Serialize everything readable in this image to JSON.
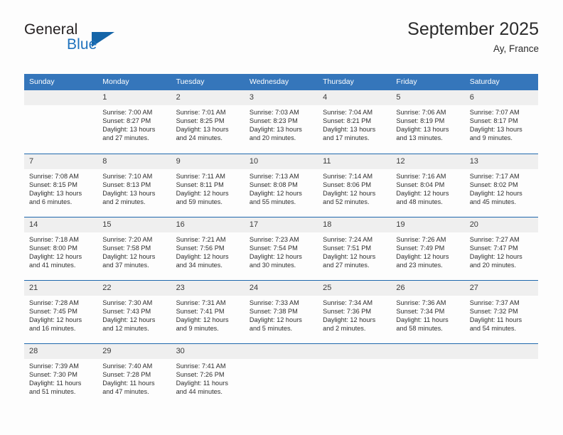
{
  "brand": {
    "name_part1": "General",
    "name_part2": "Blue"
  },
  "header": {
    "title": "September 2025",
    "location": "Ay, France"
  },
  "colors": {
    "header_blue": "#3576bb",
    "week_border_blue": "#1f68ad",
    "daynum_band": "#efefef",
    "brand_blue": "#1f72bd",
    "logo_triangle": "#1565a8",
    "text": "#2f2f2f"
  },
  "weekdays": [
    "Sunday",
    "Monday",
    "Tuesday",
    "Wednesday",
    "Thursday",
    "Friday",
    "Saturday"
  ],
  "labels": {
    "sunrise_prefix": "Sunrise:",
    "sunset_prefix": "Sunset:",
    "daylight_prefix": "Daylight:"
  },
  "weeks": [
    [
      {
        "day": "",
        "empty": true,
        "l1": "",
        "l2": "",
        "l3": "",
        "l4": ""
      },
      {
        "day": "1",
        "empty": false,
        "l1": "Sunrise: 7:00 AM",
        "l2": "Sunset: 8:27 PM",
        "l3": "Daylight: 13 hours",
        "l4": "and 27 minutes."
      },
      {
        "day": "2",
        "empty": false,
        "l1": "Sunrise: 7:01 AM",
        "l2": "Sunset: 8:25 PM",
        "l3": "Daylight: 13 hours",
        "l4": "and 24 minutes."
      },
      {
        "day": "3",
        "empty": false,
        "l1": "Sunrise: 7:03 AM",
        "l2": "Sunset: 8:23 PM",
        "l3": "Daylight: 13 hours",
        "l4": "and 20 minutes."
      },
      {
        "day": "4",
        "empty": false,
        "l1": "Sunrise: 7:04 AM",
        "l2": "Sunset: 8:21 PM",
        "l3": "Daylight: 13 hours",
        "l4": "and 17 minutes."
      },
      {
        "day": "5",
        "empty": false,
        "l1": "Sunrise: 7:06 AM",
        "l2": "Sunset: 8:19 PM",
        "l3": "Daylight: 13 hours",
        "l4": "and 13 minutes."
      },
      {
        "day": "6",
        "empty": false,
        "l1": "Sunrise: 7:07 AM",
        "l2": "Sunset: 8:17 PM",
        "l3": "Daylight: 13 hours",
        "l4": "and 9 minutes."
      }
    ],
    [
      {
        "day": "7",
        "empty": false,
        "l1": "Sunrise: 7:08 AM",
        "l2": "Sunset: 8:15 PM",
        "l3": "Daylight: 13 hours",
        "l4": "and 6 minutes."
      },
      {
        "day": "8",
        "empty": false,
        "l1": "Sunrise: 7:10 AM",
        "l2": "Sunset: 8:13 PM",
        "l3": "Daylight: 13 hours",
        "l4": "and 2 minutes."
      },
      {
        "day": "9",
        "empty": false,
        "l1": "Sunrise: 7:11 AM",
        "l2": "Sunset: 8:11 PM",
        "l3": "Daylight: 12 hours",
        "l4": "and 59 minutes."
      },
      {
        "day": "10",
        "empty": false,
        "l1": "Sunrise: 7:13 AM",
        "l2": "Sunset: 8:08 PM",
        "l3": "Daylight: 12 hours",
        "l4": "and 55 minutes."
      },
      {
        "day": "11",
        "empty": false,
        "l1": "Sunrise: 7:14 AM",
        "l2": "Sunset: 8:06 PM",
        "l3": "Daylight: 12 hours",
        "l4": "and 52 minutes."
      },
      {
        "day": "12",
        "empty": false,
        "l1": "Sunrise: 7:16 AM",
        "l2": "Sunset: 8:04 PM",
        "l3": "Daylight: 12 hours",
        "l4": "and 48 minutes."
      },
      {
        "day": "13",
        "empty": false,
        "l1": "Sunrise: 7:17 AM",
        "l2": "Sunset: 8:02 PM",
        "l3": "Daylight: 12 hours",
        "l4": "and 45 minutes."
      }
    ],
    [
      {
        "day": "14",
        "empty": false,
        "l1": "Sunrise: 7:18 AM",
        "l2": "Sunset: 8:00 PM",
        "l3": "Daylight: 12 hours",
        "l4": "and 41 minutes."
      },
      {
        "day": "15",
        "empty": false,
        "l1": "Sunrise: 7:20 AM",
        "l2": "Sunset: 7:58 PM",
        "l3": "Daylight: 12 hours",
        "l4": "and 37 minutes."
      },
      {
        "day": "16",
        "empty": false,
        "l1": "Sunrise: 7:21 AM",
        "l2": "Sunset: 7:56 PM",
        "l3": "Daylight: 12 hours",
        "l4": "and 34 minutes."
      },
      {
        "day": "17",
        "empty": false,
        "l1": "Sunrise: 7:23 AM",
        "l2": "Sunset: 7:54 PM",
        "l3": "Daylight: 12 hours",
        "l4": "and 30 minutes."
      },
      {
        "day": "18",
        "empty": false,
        "l1": "Sunrise: 7:24 AM",
        "l2": "Sunset: 7:51 PM",
        "l3": "Daylight: 12 hours",
        "l4": "and 27 minutes."
      },
      {
        "day": "19",
        "empty": false,
        "l1": "Sunrise: 7:26 AM",
        "l2": "Sunset: 7:49 PM",
        "l3": "Daylight: 12 hours",
        "l4": "and 23 minutes."
      },
      {
        "day": "20",
        "empty": false,
        "l1": "Sunrise: 7:27 AM",
        "l2": "Sunset: 7:47 PM",
        "l3": "Daylight: 12 hours",
        "l4": "and 20 minutes."
      }
    ],
    [
      {
        "day": "21",
        "empty": false,
        "l1": "Sunrise: 7:28 AM",
        "l2": "Sunset: 7:45 PM",
        "l3": "Daylight: 12 hours",
        "l4": "and 16 minutes."
      },
      {
        "day": "22",
        "empty": false,
        "l1": "Sunrise: 7:30 AM",
        "l2": "Sunset: 7:43 PM",
        "l3": "Daylight: 12 hours",
        "l4": "and 12 minutes."
      },
      {
        "day": "23",
        "empty": false,
        "l1": "Sunrise: 7:31 AM",
        "l2": "Sunset: 7:41 PM",
        "l3": "Daylight: 12 hours",
        "l4": "and 9 minutes."
      },
      {
        "day": "24",
        "empty": false,
        "l1": "Sunrise: 7:33 AM",
        "l2": "Sunset: 7:38 PM",
        "l3": "Daylight: 12 hours",
        "l4": "and 5 minutes."
      },
      {
        "day": "25",
        "empty": false,
        "l1": "Sunrise: 7:34 AM",
        "l2": "Sunset: 7:36 PM",
        "l3": "Daylight: 12 hours",
        "l4": "and 2 minutes."
      },
      {
        "day": "26",
        "empty": false,
        "l1": "Sunrise: 7:36 AM",
        "l2": "Sunset: 7:34 PM",
        "l3": "Daylight: 11 hours",
        "l4": "and 58 minutes."
      },
      {
        "day": "27",
        "empty": false,
        "l1": "Sunrise: 7:37 AM",
        "l2": "Sunset: 7:32 PM",
        "l3": "Daylight: 11 hours",
        "l4": "and 54 minutes."
      }
    ],
    [
      {
        "day": "28",
        "empty": false,
        "l1": "Sunrise: 7:39 AM",
        "l2": "Sunset: 7:30 PM",
        "l3": "Daylight: 11 hours",
        "l4": "and 51 minutes."
      },
      {
        "day": "29",
        "empty": false,
        "l1": "Sunrise: 7:40 AM",
        "l2": "Sunset: 7:28 PM",
        "l3": "Daylight: 11 hours",
        "l4": "and 47 minutes."
      },
      {
        "day": "30",
        "empty": false,
        "l1": "Sunrise: 7:41 AM",
        "l2": "Sunset: 7:26 PM",
        "l3": "Daylight: 11 hours",
        "l4": "and 44 minutes."
      },
      {
        "day": "",
        "empty": true,
        "l1": "",
        "l2": "",
        "l3": "",
        "l4": ""
      },
      {
        "day": "",
        "empty": true,
        "l1": "",
        "l2": "",
        "l3": "",
        "l4": ""
      },
      {
        "day": "",
        "empty": true,
        "l1": "",
        "l2": "",
        "l3": "",
        "l4": ""
      },
      {
        "day": "",
        "empty": true,
        "l1": "",
        "l2": "",
        "l3": "",
        "l4": ""
      }
    ]
  ]
}
